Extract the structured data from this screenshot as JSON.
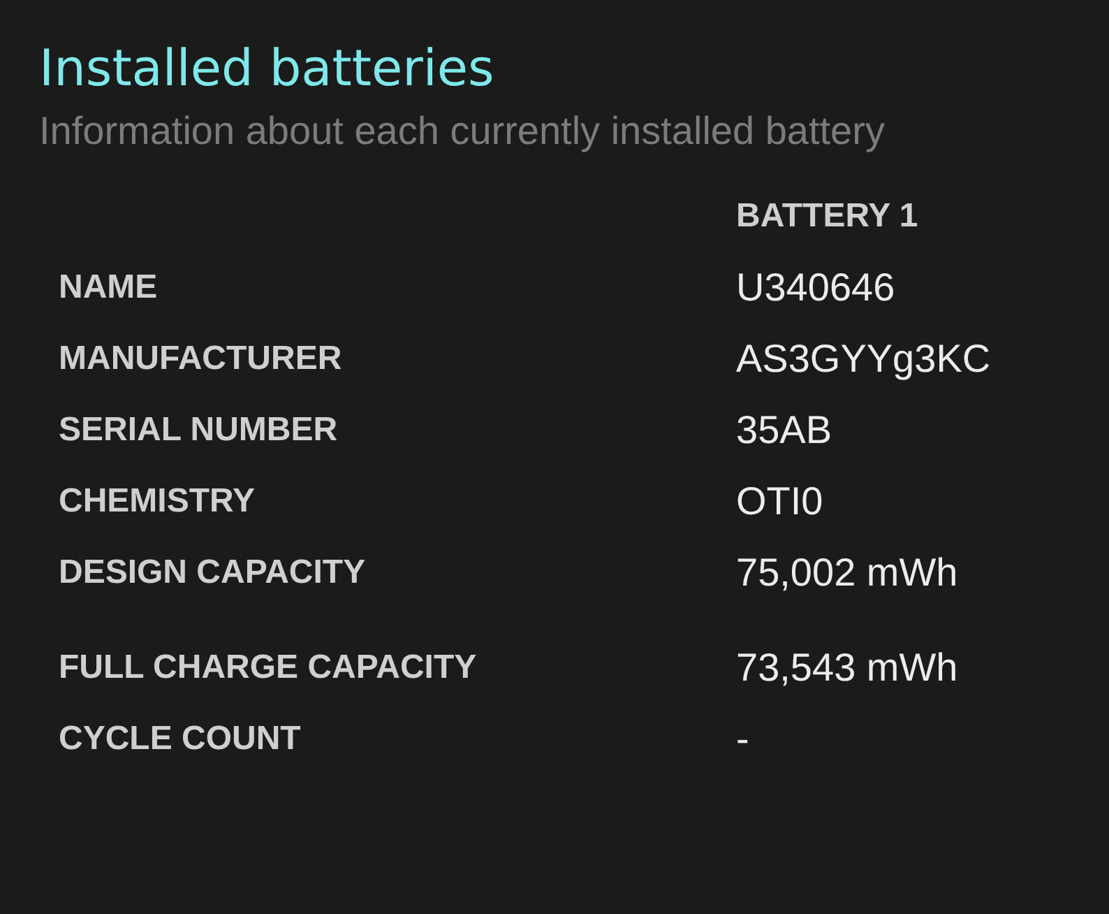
{
  "title": "Installed batteries",
  "subtitle": "Information about each currently installed battery",
  "column_header": "BATTERY 1",
  "sections": [
    {
      "rows": [
        {
          "label": "NAME",
          "value": "U340646"
        },
        {
          "label": "MANUFACTURER",
          "value": "AS3GYYg3KC"
        },
        {
          "label": "SERIAL NUMBER",
          "value": "35AB"
        },
        {
          "label": "CHEMISTRY",
          "value": "OTI0"
        },
        {
          "label": "DESIGN CAPACITY",
          "value": "75,002 mWh"
        }
      ]
    },
    {
      "rows": [
        {
          "label": "FULL CHARGE CAPACITY",
          "value": "73,543 mWh"
        },
        {
          "label": "CYCLE COUNT",
          "value": "-"
        }
      ]
    }
  ]
}
